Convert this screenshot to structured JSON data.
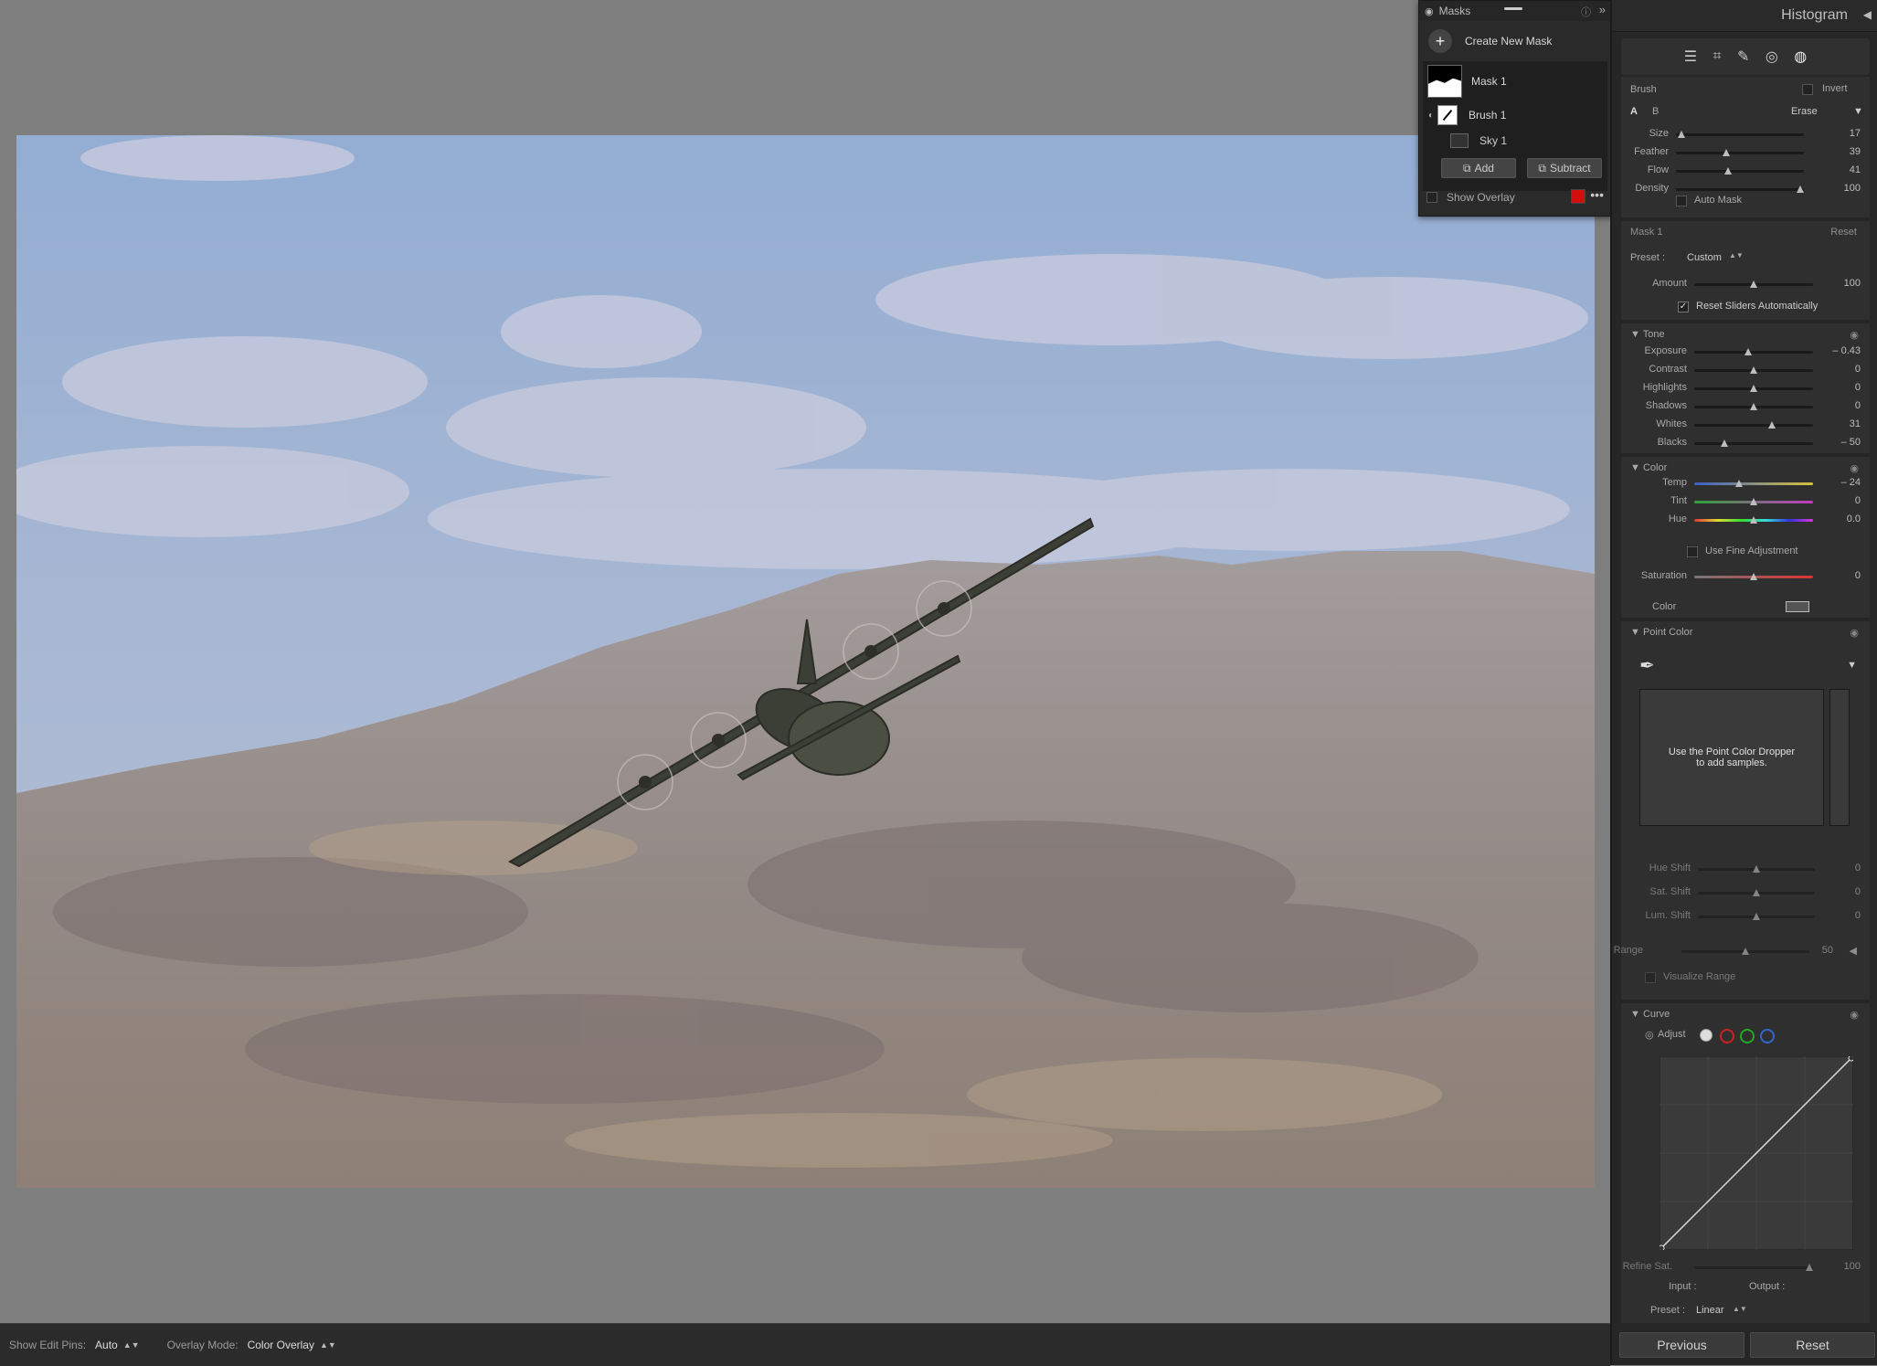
{
  "masks_panel": {
    "title": "Masks",
    "create_label": "Create New Mask",
    "items": [
      {
        "label": "Mask 1"
      },
      {
        "label": "Brush 1"
      },
      {
        "label": "Sky 1"
      }
    ],
    "add_label": "Add",
    "subtract_label": "Subtract",
    "show_overlay_label": "Show Overlay",
    "overlay_color": "#d10f0f"
  },
  "bottom_bar": {
    "edit_pins_label": "Show Edit Pins:",
    "edit_pins_value": "Auto",
    "overlay_mode_label": "Overlay Mode:",
    "overlay_mode_value": "Color Overlay"
  },
  "right_panel": {
    "histogram_label": "Histogram",
    "brush": {
      "title": "Brush",
      "invert_label": "Invert",
      "a_label": "A",
      "b_label": "B",
      "erase_label": "Erase",
      "sliders": [
        {
          "label": "Size",
          "value": "17",
          "pos": 0.04
        },
        {
          "label": "Feather",
          "value": "39",
          "pos": 0.39
        },
        {
          "label": "Flow",
          "value": "41",
          "pos": 0.41
        },
        {
          "label": "Density",
          "value": "100",
          "pos": 0.97
        }
      ],
      "auto_mask_label": "Auto Mask"
    },
    "mask": {
      "title": "Mask 1",
      "reset_label": "Reset",
      "preset_label": "Preset :",
      "preset_value": "Custom",
      "amount_label": "Amount",
      "amount_value": "100",
      "amount_pos": 0.5,
      "reset_sliders_label": "Reset Sliders Automatically"
    },
    "tone": {
      "title": "Tone",
      "sliders": [
        {
          "label": "Exposure",
          "value": "– 0.43",
          "pos": 0.45
        },
        {
          "label": "Contrast",
          "value": "0",
          "pos": 0.5
        },
        {
          "label": "Highlights",
          "value": "0",
          "pos": 0.5
        },
        {
          "label": "Shadows",
          "value": "0",
          "pos": 0.5
        },
        {
          "label": "Whites",
          "value": "31",
          "pos": 0.65
        },
        {
          "label": "Blacks",
          "value": "– 50",
          "pos": 0.25
        }
      ]
    },
    "color": {
      "title": "Color",
      "sliders": [
        {
          "label": "Temp",
          "value": "– 24",
          "pos": 0.38
        },
        {
          "label": "Tint",
          "value": "0",
          "pos": 0.5
        },
        {
          "label": "Hue",
          "value": "0.0",
          "pos": 0.5
        }
      ],
      "fine_adjust_label": "Use Fine Adjustment",
      "saturation_label": "Saturation",
      "saturation_value": "0",
      "saturation_pos": 0.5,
      "color_label": "Color"
    },
    "point_color": {
      "title": "Point Color",
      "hint_line1": "Use the Point Color Dropper",
      "hint_line2": "to add samples.",
      "sliders": [
        {
          "label": "Hue Shift",
          "value": "0",
          "pos": 0.5
        },
        {
          "label": "Sat. Shift",
          "value": "0",
          "pos": 0.5
        },
        {
          "label": "Lum. Shift",
          "value": "0",
          "pos": 0.5
        }
      ],
      "range_label": "Range",
      "range_value": "50",
      "range_pos": 0.5,
      "visualize_label": "Visualize Range"
    },
    "curve": {
      "title": "Curve",
      "adjust_label": "Adjust",
      "refine_label": "Refine Sat.",
      "refine_value": "100",
      "input_label": "Input :",
      "output_label": "Output :",
      "preset_label": "Preset :",
      "preset_value": "Linear"
    },
    "previous_label": "Previous",
    "reset_label": "Reset"
  }
}
